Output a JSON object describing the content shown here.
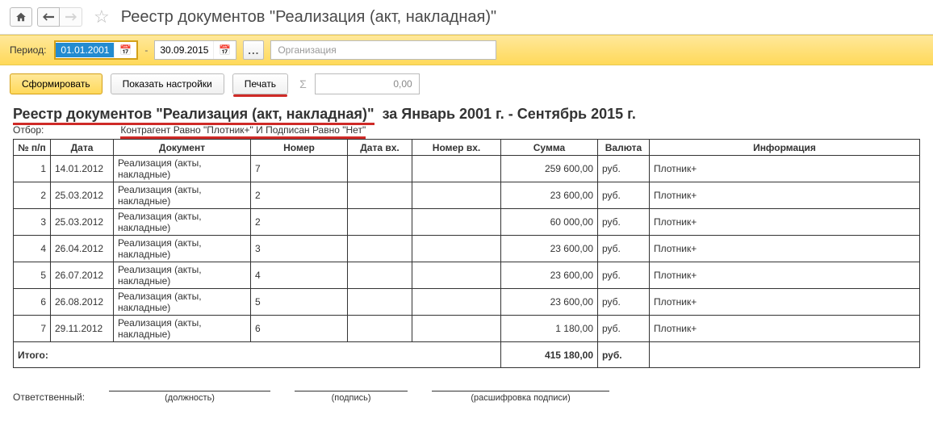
{
  "page": {
    "title": "Реестр документов \"Реализация (акт, накладная)\""
  },
  "period": {
    "label": "Период:",
    "from": "01.01.2001",
    "to": "30.09.2015",
    "dash": "-",
    "ellipsis": "...",
    "org_placeholder": "Организация"
  },
  "toolbar": {
    "generate": "Сформировать",
    "show_settings": "Показать настройки",
    "print": "Печать",
    "sigma": "Σ",
    "sum_value": "0,00"
  },
  "report": {
    "title_label": "Реестр документов \"Реализация (акт, накладная)\"",
    "title_period": "за Январь 2001 г. - Сентябрь 2015 г.",
    "filter_label": "Отбор:",
    "filter_value": "Контрагент Равно \"Плотник+\" И Подписан Равно \"Нет\"",
    "headers": {
      "num": "№ п/п",
      "date": "Дата",
      "doc": "Документ",
      "nomer": "Номер",
      "date_in": "Дата вх.",
      "nomer_in": "Номер вх.",
      "sum": "Сумма",
      "currency": "Валюта",
      "info": "Информация"
    },
    "rows": [
      {
        "n": "1",
        "date": "14.01.2012",
        "doc": "Реализация (акты, накладные)",
        "nomer": "7",
        "date_in": "",
        "nomer_in": "",
        "sum": "259 600,00",
        "cur": "руб.",
        "info": "Плотник+"
      },
      {
        "n": "2",
        "date": "25.03.2012",
        "doc": "Реализация (акты, накладные)",
        "nomer": "2",
        "date_in": "",
        "nomer_in": "",
        "sum": "23 600,00",
        "cur": "руб.",
        "info": "Плотник+"
      },
      {
        "n": "3",
        "date": "25.03.2012",
        "doc": "Реализация (акты, накладные)",
        "nomer": "2",
        "date_in": "",
        "nomer_in": "",
        "sum": "60 000,00",
        "cur": "руб.",
        "info": "Плотник+"
      },
      {
        "n": "4",
        "date": "26.04.2012",
        "doc": "Реализация (акты, накладные)",
        "nomer": "3",
        "date_in": "",
        "nomer_in": "",
        "sum": "23 600,00",
        "cur": "руб.",
        "info": "Плотник+"
      },
      {
        "n": "5",
        "date": "26.07.2012",
        "doc": "Реализация (акты, накладные)",
        "nomer": "4",
        "date_in": "",
        "nomer_in": "",
        "sum": "23 600,00",
        "cur": "руб.",
        "info": "Плотник+"
      },
      {
        "n": "6",
        "date": "26.08.2012",
        "doc": "Реализация (акты, накладные)",
        "nomer": "5",
        "date_in": "",
        "nomer_in": "",
        "sum": "23 600,00",
        "cur": "руб.",
        "info": "Плотник+"
      },
      {
        "n": "7",
        "date": "29.11.2012",
        "doc": "Реализация (акты, накладные)",
        "nomer": "6",
        "date_in": "",
        "nomer_in": "",
        "sum": "1 180,00",
        "cur": "руб.",
        "info": "Плотник+"
      }
    ],
    "totals": {
      "label": "Итого:",
      "sum": "415 180,00",
      "cur": "руб."
    },
    "signature": {
      "responsible": "Ответственный:",
      "position": "(должность)",
      "sign": "(подпись)",
      "name": "(расшифровка подписи)"
    }
  }
}
